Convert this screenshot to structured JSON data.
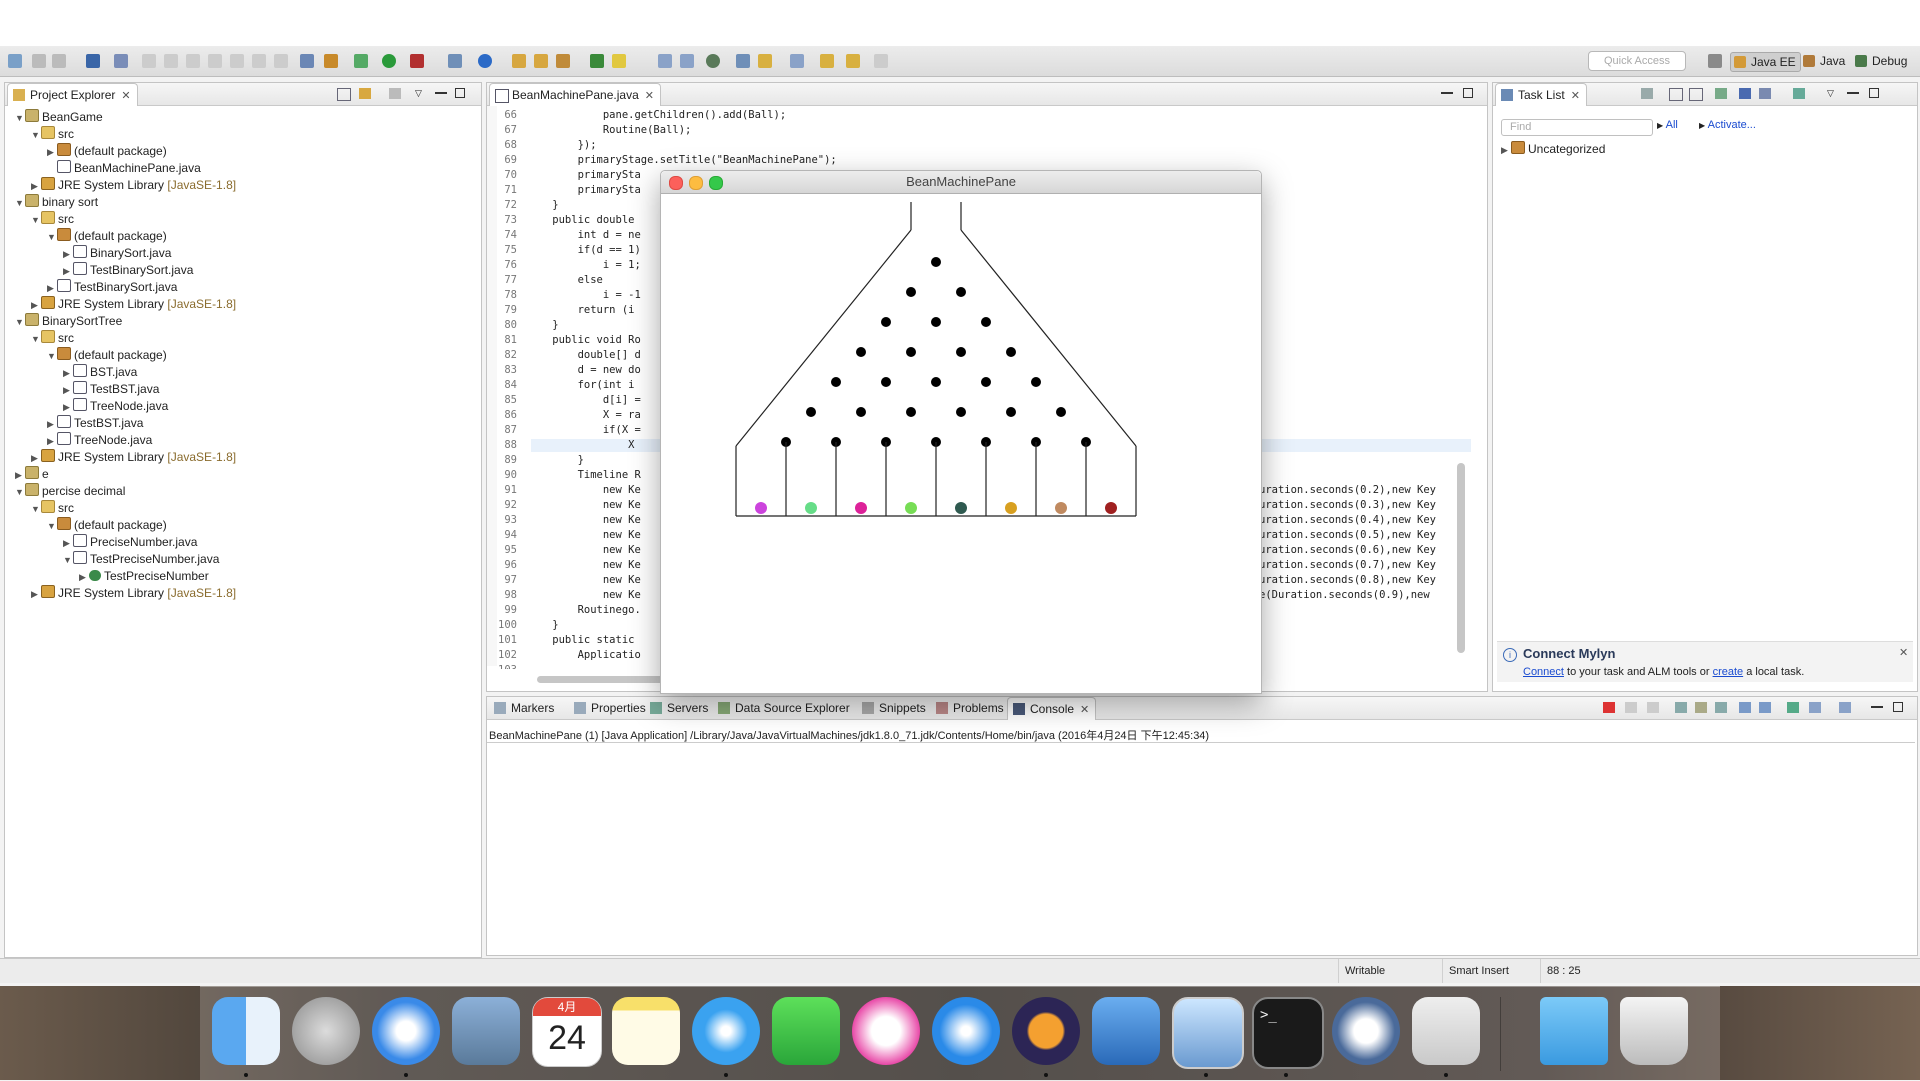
{
  "toolbar": {
    "quick_access_placeholder": "Quick Access",
    "perspectives": [
      "Java EE",
      "Java",
      "Debug"
    ]
  },
  "project_explorer": {
    "title": "Project Explorer",
    "rows": [
      {
        "label": "BeanGame",
        "level": 0,
        "icon": "project-icon",
        "twisty": "▼"
      },
      {
        "label": "src",
        "level": 1,
        "icon": "source-folder-icon",
        "twisty": "▼"
      },
      {
        "label": "(default package)",
        "level": 2,
        "icon": "package-icon",
        "twisty": "▶"
      },
      {
        "label": "BeanMachinePane.java",
        "level": 2,
        "icon": "java-file-icon",
        "twisty": ""
      },
      {
        "label": "JRE System Library",
        "tag": "[JavaSE-1.8]",
        "level": 1,
        "icon": "library-icon",
        "twisty": "▶"
      },
      {
        "label": "binary sort",
        "level": 0,
        "icon": "project-icon",
        "twisty": "▼"
      },
      {
        "label": "src",
        "level": 1,
        "icon": "source-folder-icon",
        "twisty": "▼"
      },
      {
        "label": "(default package)",
        "level": 2,
        "icon": "package-icon",
        "twisty": "▼"
      },
      {
        "label": "BinarySort.java",
        "level": 3,
        "icon": "java-file-icon",
        "twisty": "▶"
      },
      {
        "label": "TestBinarySort.java",
        "level": 3,
        "icon": "java-file-icon",
        "twisty": "▶"
      },
      {
        "label": "TestBinarySort.java",
        "level": 2,
        "icon": "java-file-icon",
        "twisty": "▶"
      },
      {
        "label": "JRE System Library",
        "tag": "[JavaSE-1.8]",
        "level": 1,
        "icon": "library-icon",
        "twisty": "▶"
      },
      {
        "label": "BinarySortTree",
        "level": 0,
        "icon": "project-icon",
        "twisty": "▼"
      },
      {
        "label": "src",
        "level": 1,
        "icon": "source-folder-icon",
        "twisty": "▼"
      },
      {
        "label": "(default package)",
        "level": 2,
        "icon": "package-icon",
        "twisty": "▼"
      },
      {
        "label": "BST.java",
        "level": 3,
        "icon": "java-file-icon",
        "twisty": "▶"
      },
      {
        "label": "TestBST.java",
        "level": 3,
        "icon": "java-file-icon",
        "twisty": "▶"
      },
      {
        "label": "TreeNode.java",
        "level": 3,
        "icon": "java-file-icon",
        "twisty": "▶"
      },
      {
        "label": "TestBST.java",
        "level": 2,
        "icon": "java-file-icon",
        "twisty": "▶"
      },
      {
        "label": "TreeNode.java",
        "level": 2,
        "icon": "java-file-icon",
        "twisty": "▶"
      },
      {
        "label": "JRE System Library",
        "tag": "[JavaSE-1.8]",
        "level": 1,
        "icon": "library-icon",
        "twisty": "▶"
      },
      {
        "label": "e",
        "level": 0,
        "icon": "project-icon",
        "twisty": "▶"
      },
      {
        "label": "percise decimal",
        "level": 0,
        "icon": "project-icon",
        "twisty": "▼"
      },
      {
        "label": "src",
        "level": 1,
        "icon": "source-folder-icon",
        "twisty": "▼"
      },
      {
        "label": "(default package)",
        "level": 2,
        "icon": "package-icon",
        "twisty": "▼"
      },
      {
        "label": "PreciseNumber.java",
        "level": 3,
        "icon": "java-file-icon",
        "twisty": "▶"
      },
      {
        "label": "TestPreciseNumber.java",
        "level": 3,
        "icon": "java-file-icon",
        "twisty": "▼"
      },
      {
        "label": "TestPreciseNumber",
        "level": 4,
        "icon": "class-icon",
        "twisty": "▶"
      },
      {
        "label": "JRE System Library",
        "tag": "[JavaSE-1.8]",
        "level": 1,
        "icon": "library-icon",
        "twisty": "▶"
      }
    ]
  },
  "editor": {
    "tab_label": "BeanMachinePane.java",
    "lines": [
      {
        "n": "66",
        "t": "            pane.getChildren().add(Ball);"
      },
      {
        "n": "67",
        "t": "            Routine(Ball);"
      },
      {
        "n": "68",
        "t": "        });"
      },
      {
        "n": "69",
        "t": "        primaryStage.setTitle(\"BeanMachinePane\");"
      },
      {
        "n": "70",
        "t": "        primarySta"
      },
      {
        "n": "71",
        "t": "        primarySta"
      },
      {
        "n": "72",
        "t": "    }"
      },
      {
        "n": "73",
        "t": "    public double"
      },
      {
        "n": "74",
        "t": "        int d = ne"
      },
      {
        "n": "75",
        "t": "        if(d == 1)"
      },
      {
        "n": "76",
        "t": "            i = 1;"
      },
      {
        "n": "77",
        "t": "        else"
      },
      {
        "n": "78",
        "t": "            i = -1"
      },
      {
        "n": "79",
        "t": "        return (i"
      },
      {
        "n": "80",
        "t": "    }"
      },
      {
        "n": "81",
        "t": "    public void Ro"
      },
      {
        "n": "82",
        "t": "        double[] d"
      },
      {
        "n": "83",
        "t": "        d = new do"
      },
      {
        "n": "84",
        "t": "        for(int i"
      },
      {
        "n": "85",
        "t": "            d[i] ="
      },
      {
        "n": "86",
        "t": "            X = ra"
      },
      {
        "n": "87",
        "t": "            if(X ="
      },
      {
        "n": "88",
        "t": "                X"
      },
      {
        "n": "89",
        "t": "        }"
      },
      {
        "n": "90",
        "t": "        Timeline R"
      },
      {
        "n": "91",
        "t": "            new Ke"
      },
      {
        "n": "92",
        "t": "            new Ke"
      },
      {
        "n": "93",
        "t": "            new Ke"
      },
      {
        "n": "94",
        "t": "            new Ke"
      },
      {
        "n": "95",
        "t": "            new Ke"
      },
      {
        "n": "96",
        "t": "            new Ke"
      },
      {
        "n": "97",
        "t": "            new Ke"
      },
      {
        "n": "98",
        "t": "            new Ke"
      },
      {
        "n": "99",
        "t": "        Routinego."
      },
      {
        "n": "100",
        "t": "    }"
      },
      {
        "n": "101",
        "t": "    public static"
      },
      {
        "n": "102",
        "t": "        Applicatio"
      },
      {
        "n": "103",
        "t": ""
      }
    ],
    "right_fragments": [
      {
        "line": "91",
        "t": "uration.seconds(0.2),new Key"
      },
      {
        "line": "92",
        "t": "uration.seconds(0.3),new Key"
      },
      {
        "line": "93",
        "t": "uration.seconds(0.4),new Key"
      },
      {
        "line": "94",
        "t": "uration.seconds(0.5),new Key"
      },
      {
        "line": "95",
        "t": "uration.seconds(0.6),new Key"
      },
      {
        "line": "96",
        "t": "uration.seconds(0.7),new Key"
      },
      {
        "line": "97",
        "t": "uration.seconds(0.8),new Key"
      },
      {
        "line": "98",
        "t": "e(Duration.seconds(0.9),new"
      }
    ]
  },
  "task_list": {
    "title": "Task List",
    "find_placeholder": "Find",
    "all_label": "All",
    "activate_label": "Activate...",
    "category": "Uncategorized"
  },
  "mylyn": {
    "title": "Connect Mylyn",
    "link1": "Connect",
    "text1": " to your task and ALM tools or ",
    "link2": "create",
    "text2": " a local task."
  },
  "bottom_tabs": [
    "Markers",
    "Properties",
    "Servers",
    "Data Source Explorer",
    "Snippets",
    "Problems",
    "Console"
  ],
  "console": {
    "header": "BeanMachinePane (1) [Java Application] /Library/Java/JavaVirtualMachines/jdk1.8.0_71.jdk/Contents/Home/bin/java (2016年4月24日 下午12:45:34)"
  },
  "app_window": {
    "title": "BeanMachinePane",
    "ball_colors": [
      "#cc44dd",
      "#66dd88",
      "#dd2299",
      "#77dd55",
      "#2f5a50",
      "#d8a020",
      "#c08a60",
      "#a02020"
    ]
  },
  "statusbar": {
    "writable": "Writable",
    "insert_mode": "Smart Insert",
    "position": "88 : 25"
  },
  "dock": {
    "calendar_month": "4月",
    "calendar_day": "24",
    "apps": [
      "finder-icon",
      "launchpad-icon",
      "safari-icon",
      "preview-icon",
      "calendar-icon",
      "notes-icon",
      "messages-icon",
      "facetime-icon",
      "itunes-icon",
      "app-store-icon",
      "eclipse-icon",
      "xcode-icon",
      "system-monitor-icon",
      "terminal-icon",
      "unity-icon",
      "script-editor-icon",
      "downloads-folder-icon",
      "trash-icon"
    ]
  }
}
